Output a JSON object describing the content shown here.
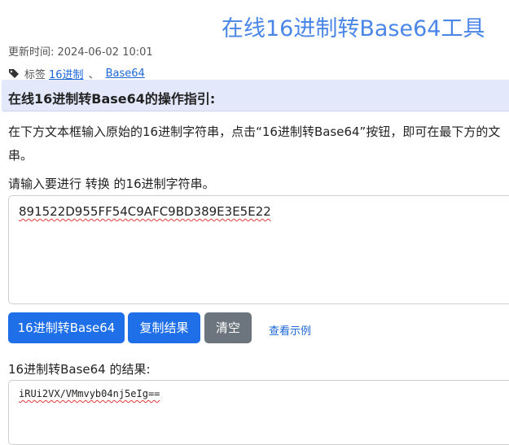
{
  "header": {
    "title": "在线16进制转Base64工具",
    "updated": "更新时间: 2024-06-02 10:01"
  },
  "tags": {
    "label": "标签",
    "separator": "、",
    "items": [
      "16进制",
      "Base64"
    ],
    "icon": "tag-icon"
  },
  "guide": {
    "title": "在线16进制转Base64的操作指引:",
    "line1": "在下方文本框输入原始的16进制字符串，点击“16进制转Base64”按钮，即可在最下方的文",
    "line2": "串。"
  },
  "input": {
    "prompt": "请输入要进行 转换 的16进制字符串。",
    "value": "891522D955FF54C9AFC9BD389E3E5E22"
  },
  "buttons": {
    "convert": "16进制转Base64",
    "copy": "复制结果",
    "clear": "清空",
    "example": "查看示例"
  },
  "colors": {
    "title": "#4a86e8",
    "primary": "#1f6fe9",
    "secondary": "#6c757d",
    "link": "#1a66d6",
    "guide_bg": "#e3e9fb"
  },
  "output": {
    "label": "16进制转Base64 的结果:",
    "value": "iRUi2VX/VMmvyb04nj5eIg=="
  }
}
